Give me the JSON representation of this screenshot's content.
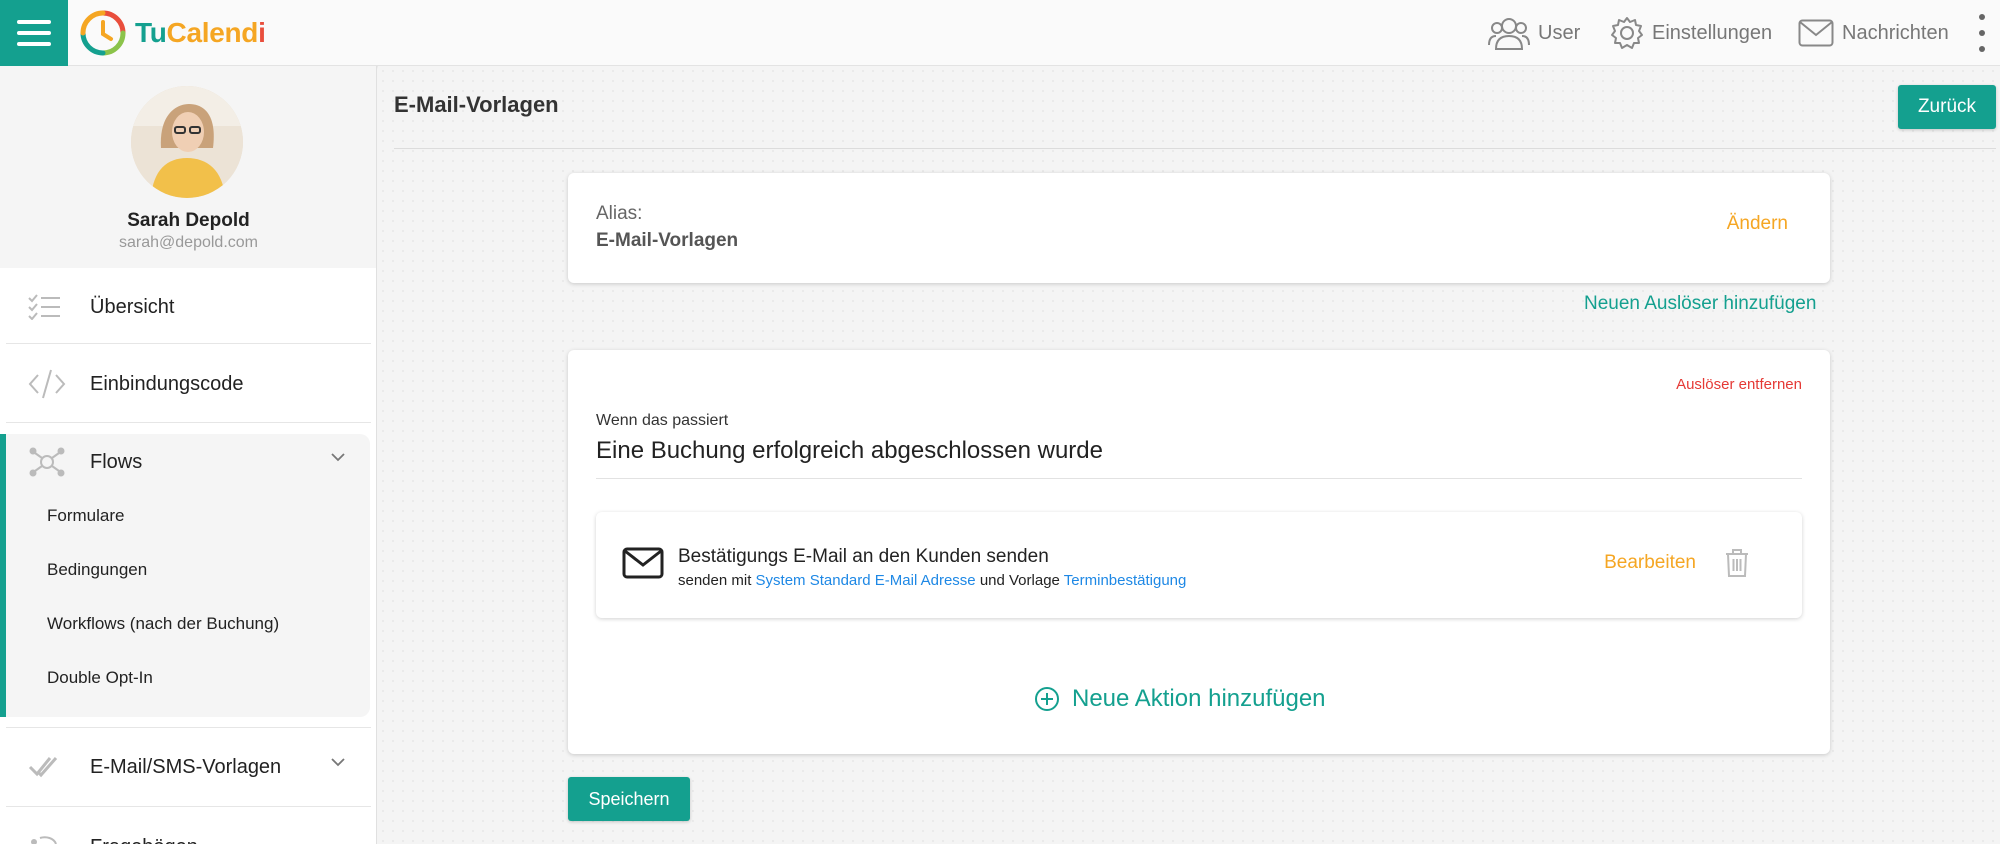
{
  "app": {
    "logo_text": {
      "tu": "Tu",
      "cal": "Calend",
      "i": "i"
    }
  },
  "topbar": {
    "user_label": "User",
    "settings_label": "Einstellungen",
    "messages_label": "Nachrichten"
  },
  "profile": {
    "name": "Sarah Depold",
    "email": "sarah@depold.com"
  },
  "sidebar": {
    "items": [
      {
        "label": "Übersicht",
        "icon": "checklist-icon"
      },
      {
        "label": "Einbindungscode",
        "icon": "code-icon"
      },
      {
        "label": "Flows",
        "icon": "flows-icon",
        "expanded": true
      },
      {
        "label": "E-Mail/SMS-Vorlagen",
        "icon": "double-check-icon"
      },
      {
        "label": "Fragebögen",
        "icon": "questionnaire-icon"
      }
    ],
    "flows_sub": [
      "Formulare",
      "Bedingungen",
      "Workflows (nach der Buchung)",
      "Double Opt-In"
    ]
  },
  "main": {
    "title": "E-Mail-Vorlagen",
    "back_label": "Zurück",
    "alias": {
      "label": "Alias:",
      "value": "E-Mail-Vorlagen",
      "change_label": "Ändern"
    },
    "add_trigger_label": "Neuen Auslöser hinzufügen",
    "trigger": {
      "remove_label": "Auslöser entfernen",
      "when_label": "Wenn das passiert",
      "when_value": "Eine Buchung erfolgreich abgeschlossen wurde",
      "action": {
        "title": "Bestätigungs E-Mail an den Kunden senden",
        "sub_prefix": "senden mit",
        "sender_link": "System Standard E-Mail Adresse",
        "sub_middle": "und Vorlage",
        "template_link": "Terminbestätigung",
        "edit_label": "Bearbeiten"
      },
      "add_action_label": "Neue Aktion hinzufügen"
    },
    "save_label": "Speichern"
  },
  "colors": {
    "accent": "#14a08f",
    "orange": "#f5a623",
    "danger": "#e53935",
    "link": "#1e88e5"
  }
}
